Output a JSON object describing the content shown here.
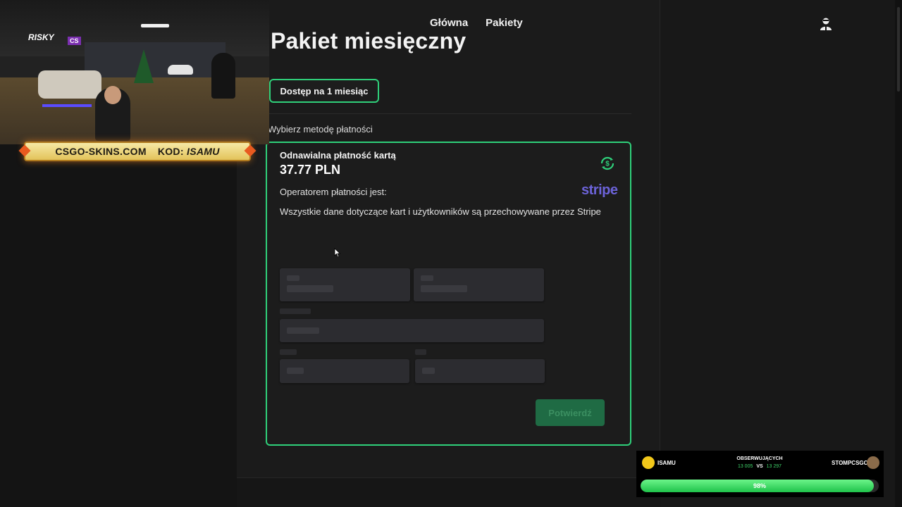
{
  "nav": {
    "home": "Główna",
    "packages": "Pakiety"
  },
  "page": {
    "title": "Pakiet miesięczny",
    "access_option": "Dostęp na 1 miesiąc",
    "choose_payment": "Wybierz metodę płatności"
  },
  "payment": {
    "method": "Odnawialna płatność kartą",
    "price": "37.77 PLN",
    "operator": "Operatorem płatności jest:",
    "operator_logo": "stripe",
    "notice": "Wszystkie dane dotyczące kart i użytkowników są przechowywane przez Stripe",
    "confirm": "Potwierdź"
  },
  "overlay": {
    "banner_site": "CSGO-SKINS.COM",
    "banner_code_label": "KOD:",
    "banner_code": "ISAMU",
    "wall_logo": "RISKY"
  },
  "battle": {
    "left_name": "ISAMU",
    "right_name": "STOMPCSGO",
    "heading": "OBSERWUJĄCYCH",
    "left_count": "13 005",
    "vs": "VS",
    "right_count": "13 297",
    "percent_label": "98%",
    "progress": 0.98
  },
  "colors": {
    "accent": "#2fd07a",
    "confirm_bg": "#1f6b44",
    "stripe": "#6c63d9"
  },
  "icons": [
    "user-icon",
    "renew-icon",
    "cursor-icon"
  ]
}
